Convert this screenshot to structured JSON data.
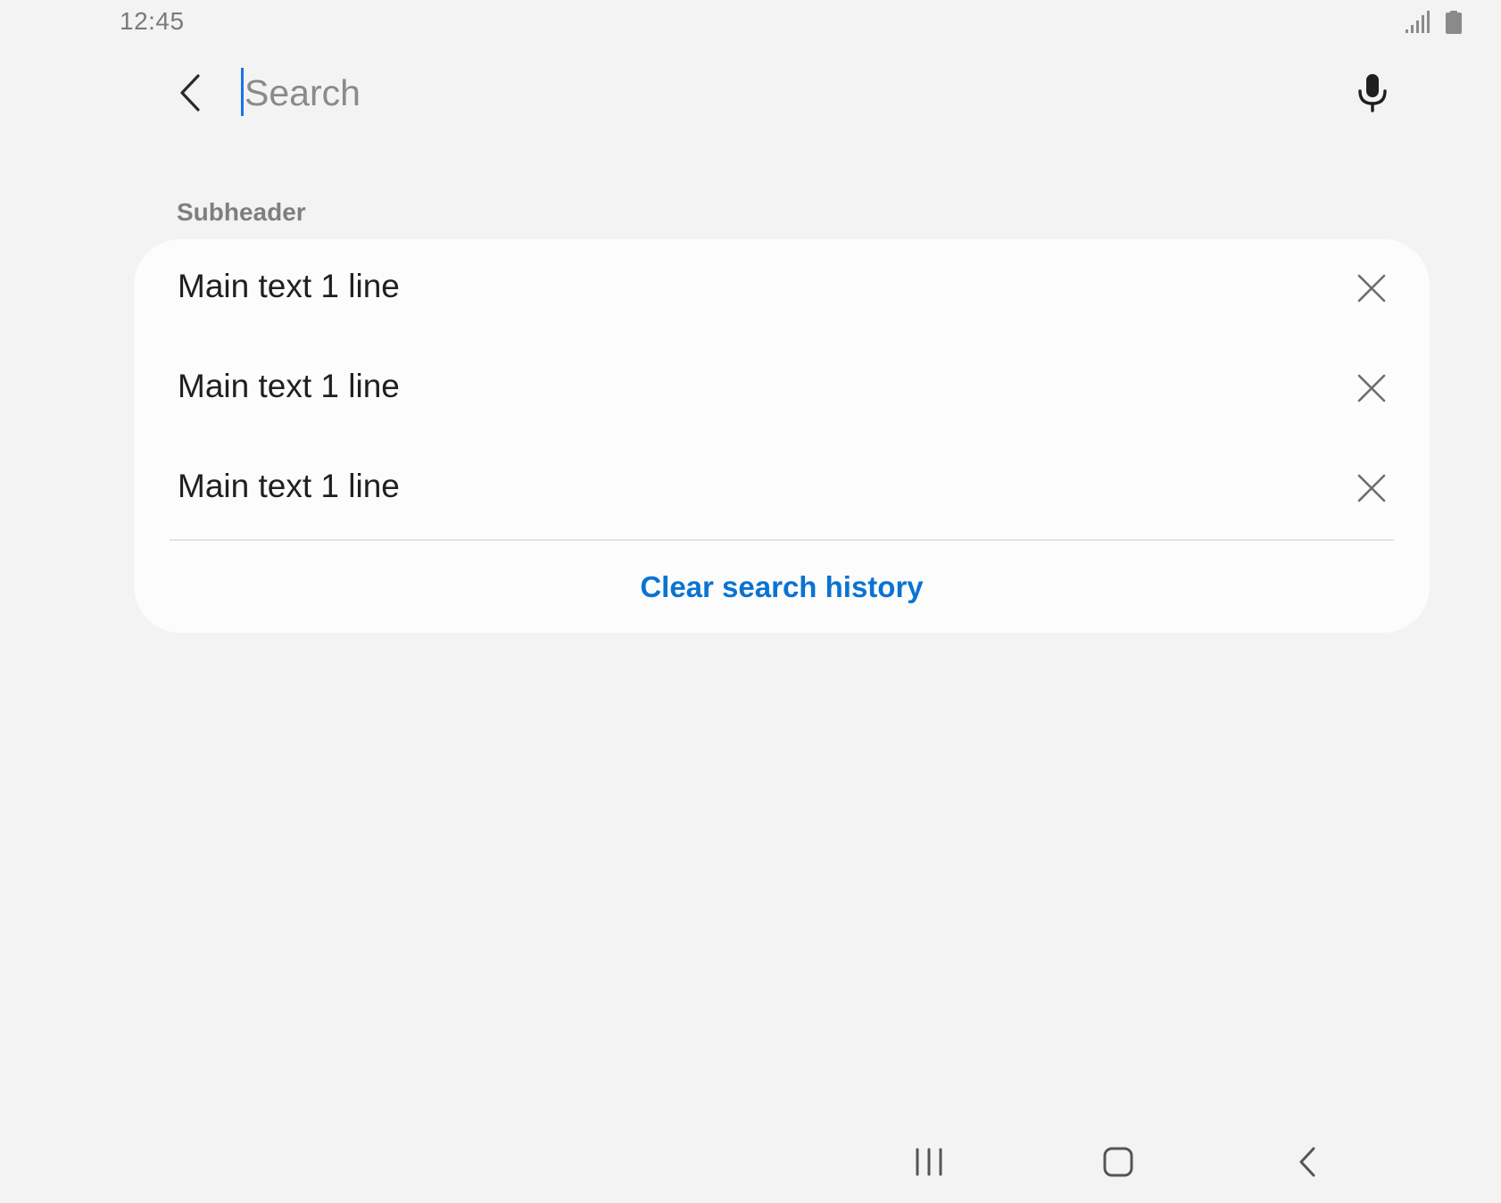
{
  "status_bar": {
    "time": "12:45",
    "signal_icon": "signal-icon",
    "battery_icon": "battery-icon"
  },
  "search": {
    "placeholder": "Search",
    "value": "",
    "back_icon": "back-arrow-icon",
    "mic_icon": "microphone-icon"
  },
  "history": {
    "subheader": "Subheader",
    "items": [
      {
        "label": "Main text 1 line",
        "remove_icon": "close-icon"
      },
      {
        "label": "Main text 1 line",
        "remove_icon": "close-icon"
      },
      {
        "label": "Main text 1 line",
        "remove_icon": "close-icon"
      }
    ],
    "clear_label": "Clear search history"
  },
  "navigation_bar": {
    "recents_icon": "recents-icon",
    "home_icon": "home-icon",
    "back_icon": "nav-back-icon"
  },
  "colors": {
    "background": "#f3f3f3",
    "card": "#fcfcfc",
    "accent": "#0a73d1",
    "caret": "#1a73e8"
  }
}
